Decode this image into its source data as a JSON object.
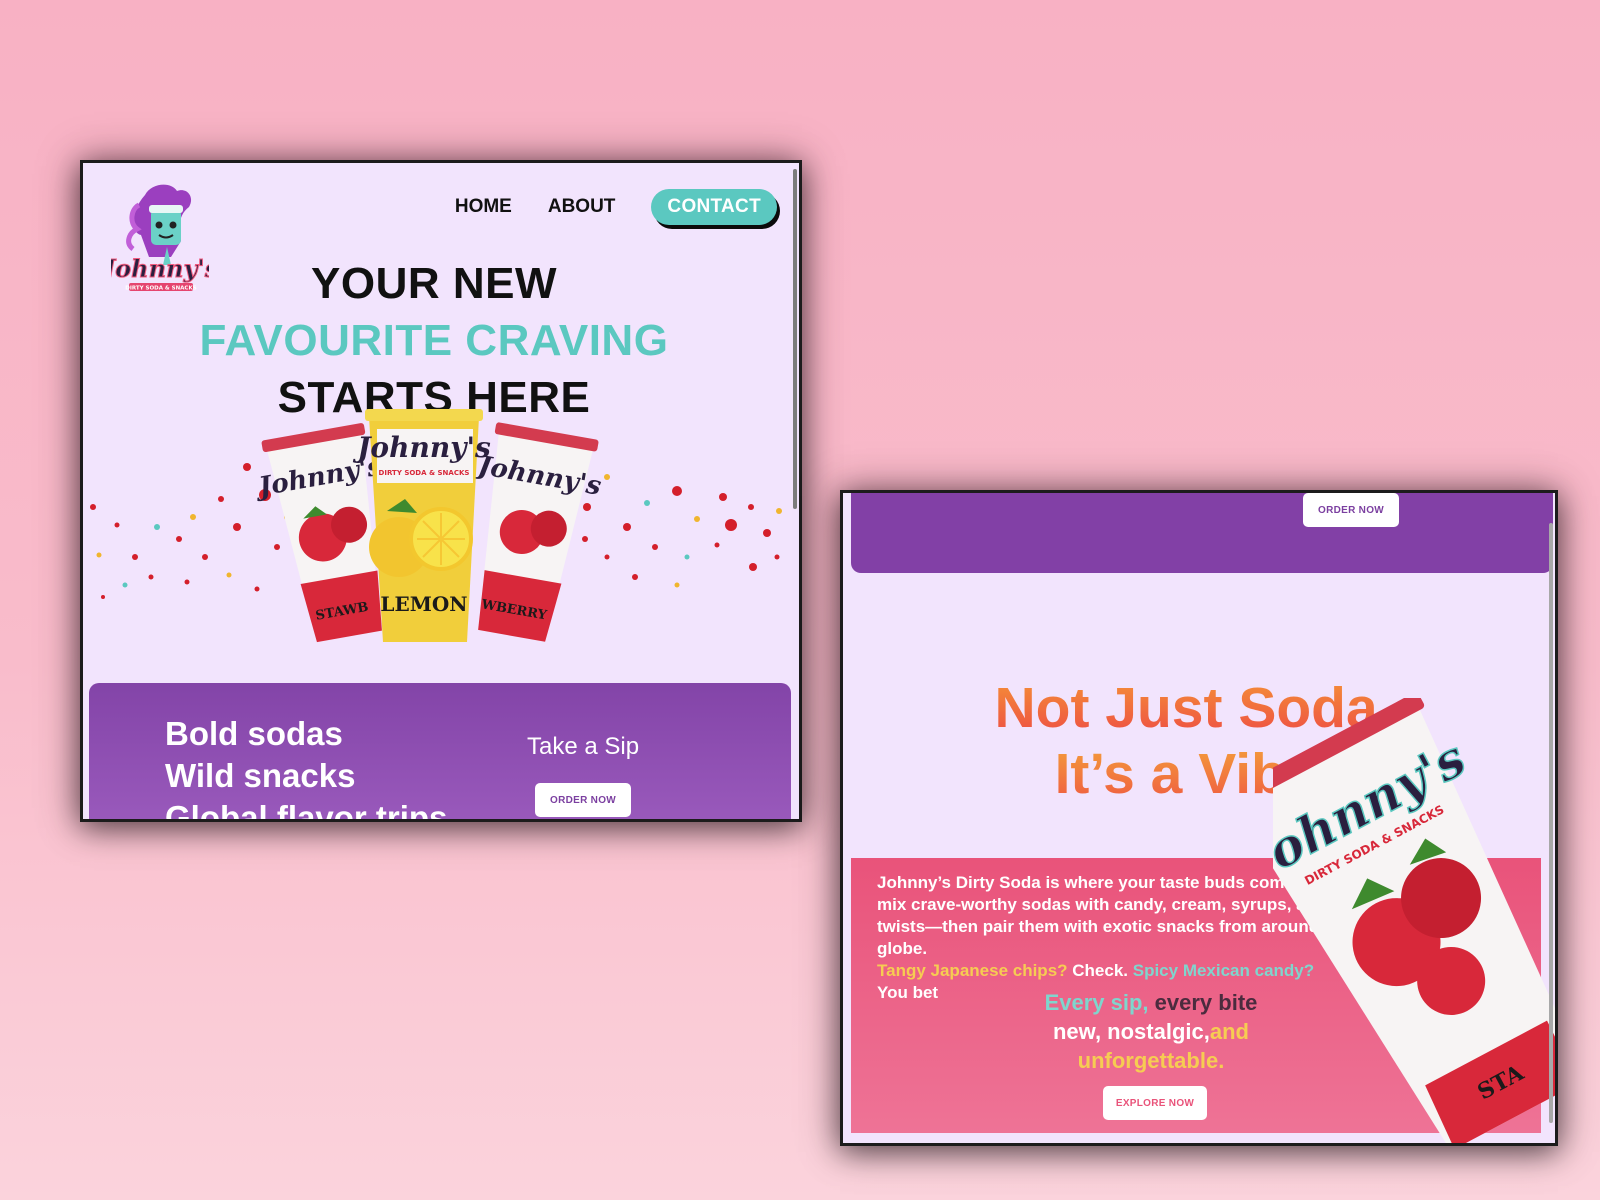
{
  "window1": {
    "logo": {
      "name": "Johnny's",
      "subtitle": "DIRTY SODA & SNACKS"
    },
    "nav": {
      "home": "HOME",
      "about": "ABOUT",
      "contact": "CONTACT"
    },
    "hero": {
      "line1": "YOUR NEW",
      "line2": "FAVOURITE CRAVING",
      "line3": "STARTS HERE"
    },
    "cups": {
      "left_label": "STAWB",
      "center_label": "LEMON",
      "right_label": "WBERRY",
      "brand": "Johnny's",
      "brand_sub": "DIRTY SODA & SNACKS"
    },
    "promo": {
      "lines": [
        "Bold sodas",
        "Wild snacks",
        "Global flavor trips"
      ],
      "sip": "Take a Sip",
      "button": "ORDER NOW"
    }
  },
  "window2": {
    "top_button": "ORDER NOW",
    "headline": {
      "line1": "Not Just Soda,",
      "line2": "It’s a Vibe."
    },
    "about": {
      "p1": "Johnny’s Dirty Soda is where your taste buds come to party. We mix crave-worthy sodas with candy, cream, syrups, and wild twists—then pair them with exotic snacks from aroundthe globe.",
      "tangy": "Tangy Japanese chips?",
      "check": " Check. ",
      "spicy": "Spicy Mexican candy?",
      "you_bet": "You bet"
    },
    "tagline": {
      "every_sip": "Every sip,",
      "every_bite": " every bite",
      "new": "new, nostalgic,",
      "and": "and",
      "unforgettable": "unforgettable."
    },
    "explore_button": "EXPLORE NOW",
    "big_cup": {
      "brand": "Johnny's",
      "brand_sub": "DIRTY SODA & SNACKS",
      "label": "STA"
    }
  },
  "colors": {
    "background": "#f8b1c4",
    "lavender": "#f2e4fd",
    "teal": "#5bc8c0",
    "purple": "#8344a8",
    "pink": "#e9537a",
    "orange": "#f0563e",
    "yellow": "#f6cc52"
  }
}
